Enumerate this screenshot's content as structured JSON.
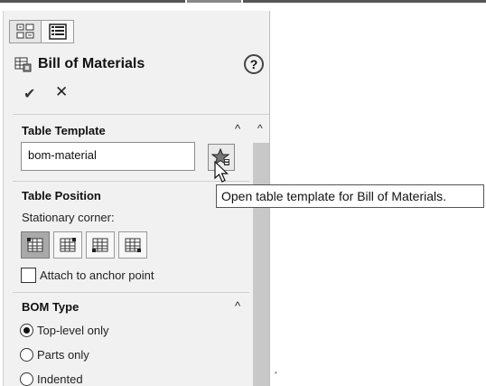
{
  "panel": {
    "title": "Bill of Materials",
    "help_symbol": "?",
    "ok_symbol": "✔",
    "cancel_symbol": "✕",
    "collapse_symbol": "^",
    "scroll_up_symbol": "^",
    "tabs": [
      {
        "icon": "property-manager-icon"
      },
      {
        "icon": "configuration-list-icon"
      }
    ]
  },
  "table_template": {
    "title": "Table Template",
    "value": "bom-material",
    "button_icon": "open-template-star-icon"
  },
  "table_position": {
    "title": "Table Position",
    "corner_label": "Stationary corner:",
    "corners": [
      {
        "icon": "corner-top-left-icon",
        "active": true
      },
      {
        "icon": "corner-top-right-icon",
        "active": false
      },
      {
        "icon": "corner-bottom-left-icon",
        "active": false
      },
      {
        "icon": "corner-bottom-right-icon",
        "active": false
      }
    ],
    "attach_label": "Attach to anchor point",
    "attach_checked": false
  },
  "bom_type": {
    "title": "BOM Type",
    "options": [
      {
        "label": "Top-level only",
        "selected": true
      },
      {
        "label": "Parts only",
        "selected": false
      },
      {
        "label": "Indented",
        "selected": false
      }
    ]
  },
  "tooltip": {
    "text": "Open table template for Bill of Materials."
  },
  "colors": {
    "panel_bg": "#f1f1f1",
    "scroll_track": "#c8c8c8",
    "active_corner": "#a9a9a9"
  }
}
